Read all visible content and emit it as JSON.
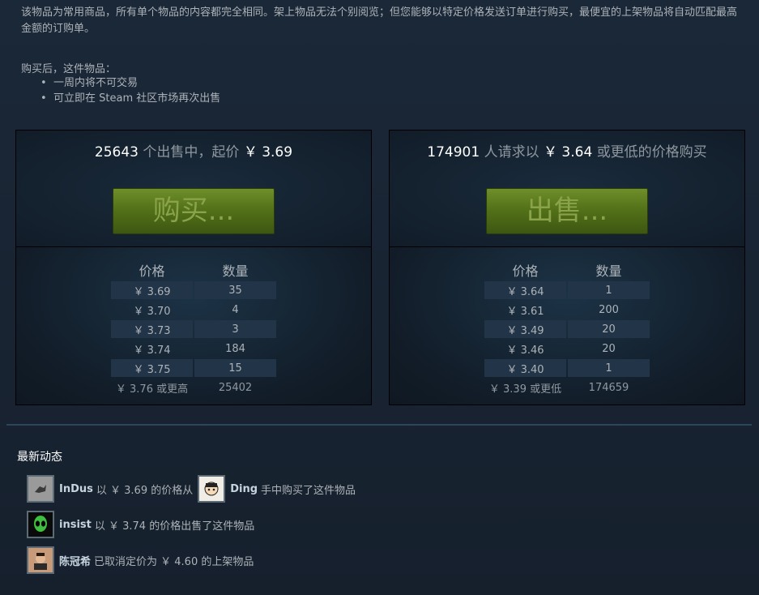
{
  "intro": "该物品为常用商品，所有单个物品的内容都完全相同。架上物品无法个别阅览；但您能够以特定价格发送订单进行购买，最便宜的上架物品将自动匹配最高金额的订购单。",
  "after": {
    "title": "购买后，这件物品：",
    "items": [
      "一周内将不可交易",
      "可立即在 Steam 社区市场再次出售"
    ]
  },
  "sell_panel": {
    "count": "25643",
    "text1": "个出售中，起价",
    "price": "￥ 3.69",
    "button": "购买...",
    "headers": {
      "price": "价格",
      "qty": "数量"
    },
    "rows": [
      {
        "price": "￥ 3.69",
        "qty": "35"
      },
      {
        "price": "￥ 3.70",
        "qty": "4"
      },
      {
        "price": "￥ 3.73",
        "qty": "3"
      },
      {
        "price": "￥ 3.74",
        "qty": "184"
      },
      {
        "price": "￥ 3.75",
        "qty": "15"
      },
      {
        "price": "￥ 3.76 或更高",
        "qty": "25402"
      }
    ]
  },
  "buy_panel": {
    "count": "174901",
    "text1": "人请求以",
    "price": "￥ 3.64",
    "text2": "或更低的价格购买",
    "button": "出售...",
    "headers": {
      "price": "价格",
      "qty": "数量"
    },
    "rows": [
      {
        "price": "￥ 3.64",
        "qty": "1"
      },
      {
        "price": "￥ 3.61",
        "qty": "200"
      },
      {
        "price": "￥ 3.49",
        "qty": "20"
      },
      {
        "price": "￥ 3.46",
        "qty": "20"
      },
      {
        "price": "￥ 3.40",
        "qty": "1"
      },
      {
        "price": "￥ 3.39 或更低",
        "qty": "174659"
      }
    ]
  },
  "activity": {
    "title": "最新动态",
    "items": [
      {
        "user": "InDus",
        "text": "以 ￥ 3.69 的价格从",
        "user2": "Ding",
        "text2": "手中购买了这件物品"
      },
      {
        "user": "insist",
        "text": "以 ￥ 3.74 的价格出售了这件物品"
      },
      {
        "user": "陈冠希",
        "text": "已取消定价为 ￥ 4.60 的上架物品"
      }
    ]
  },
  "icons": {
    "avatar1": "avatar-icon",
    "avatar2": "avatar-icon",
    "avatar3": "alien-avatar-icon",
    "avatar4": "avatar-icon"
  }
}
